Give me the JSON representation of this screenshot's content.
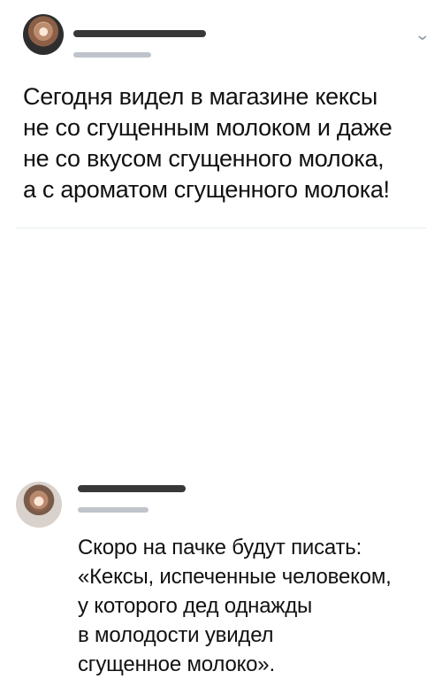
{
  "tweet_main": {
    "icon": "chevron-down-icon",
    "text": "Сегодня видел в магазине кексы\nне со сгущенным молоком и даже\nне со вкусом сгущенного молока,\nа с ароматом сгущенного молока!"
  },
  "tweet_reply": {
    "text": "Скоро на пачке будут писать:\n«Кексы, испеченные человеком,\nу которого дед однажды\nв молодости увидел\nсгущенное молоко»."
  }
}
